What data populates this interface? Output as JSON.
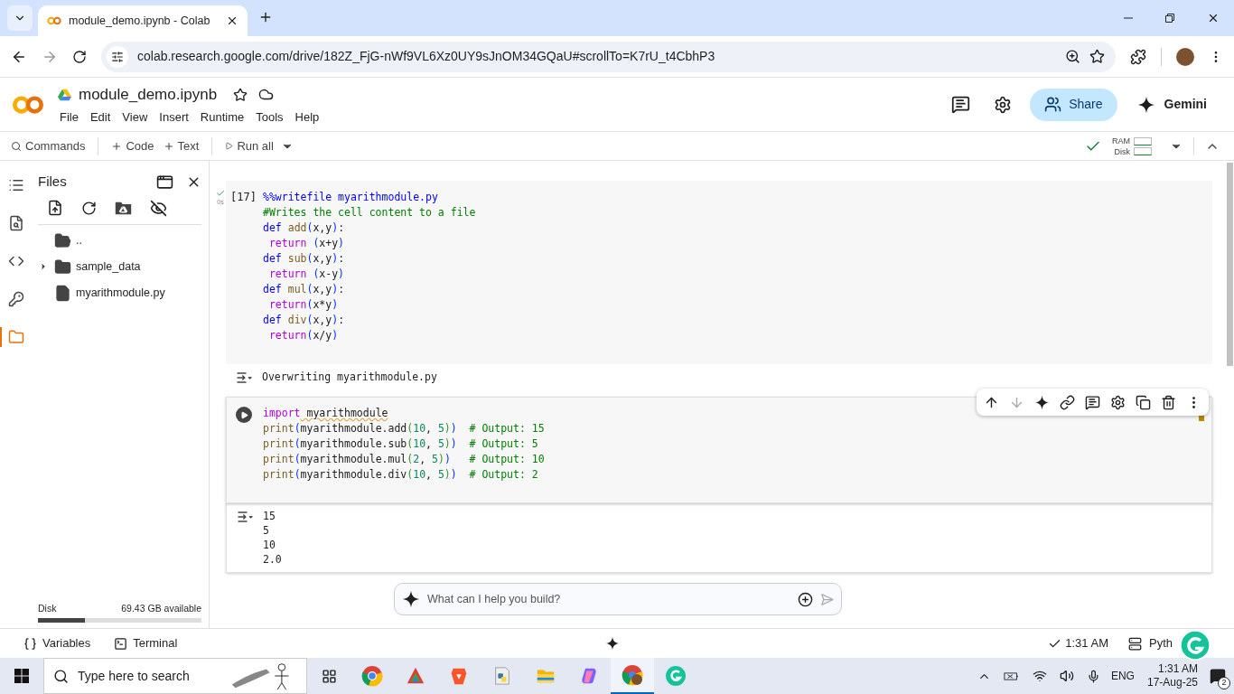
{
  "browser": {
    "tab_title": "module_demo.ipynb - Colab",
    "url": "colab.research.google.com/drive/182Z_FjG-nWf9VL6Xz0UY9sJnOM34GQaU#scrollTo=K7rU_t4CbhP3"
  },
  "notebook": {
    "title": "module_demo.ipynb",
    "menu": [
      "File",
      "Edit",
      "View",
      "Insert",
      "Runtime",
      "Tools",
      "Help"
    ],
    "share": "Share",
    "gemini": "Gemini"
  },
  "toolbar": {
    "commands": "Commands",
    "add_code": "Code",
    "add_text": "Text",
    "run_all": "Run all",
    "ram": "RAM",
    "disk": "Disk"
  },
  "rail": [
    {
      "kind": "toc",
      "selected": false
    },
    {
      "kind": "search",
      "selected": false
    },
    {
      "kind": "code",
      "selected": false
    },
    {
      "kind": "secrets",
      "selected": false
    },
    {
      "kind": "files",
      "selected": true
    }
  ],
  "files_panel": {
    "title": "Files",
    "items": [
      {
        "kind": "parent",
        "name": ".."
      },
      {
        "kind": "folder",
        "name": "sample_data",
        "expanded": false
      },
      {
        "kind": "file",
        "name": "myarithmodule.py"
      }
    ],
    "disk": {
      "label": "Disk",
      "available": "69.43 GB available",
      "level": 0.29
    }
  },
  "cells": [
    {
      "execution_count": "[17]",
      "duration": "0s",
      "selected": false,
      "lines": [
        [
          {
            "kind": "magic",
            "text": "%%writefile myarithmodule.py"
          }
        ],
        [
          {
            "kind": "comment",
            "text": "#Writes the cell content to a file"
          }
        ],
        [
          {
            "kind": "kw",
            "text": "def"
          },
          {
            "kind": "fn",
            "text": " add"
          },
          {
            "kind": "paren",
            "text": "("
          },
          {
            "kind": "plain",
            "text": "x,y"
          },
          {
            "kind": "paren",
            "text": ")"
          },
          {
            "kind": "plain",
            "text": ":"
          }
        ],
        [
          {
            "kind": "ctrl",
            "text": " return"
          },
          {
            "kind": "paren",
            "text": " ("
          },
          {
            "kind": "plain",
            "text": "x+y"
          },
          {
            "kind": "paren",
            "text": ")"
          }
        ],
        [
          {
            "kind": "kw",
            "text": "def"
          },
          {
            "kind": "fn",
            "text": " sub"
          },
          {
            "kind": "paren",
            "text": "("
          },
          {
            "kind": "plain",
            "text": "x,y"
          },
          {
            "kind": "paren",
            "text": ")"
          },
          {
            "kind": "plain",
            "text": ":"
          }
        ],
        [
          {
            "kind": "ctrl",
            "text": " return"
          },
          {
            "kind": "paren",
            "text": " ("
          },
          {
            "kind": "plain",
            "text": "x-y"
          },
          {
            "kind": "paren",
            "text": ")"
          }
        ],
        [
          {
            "kind": "kw",
            "text": "def"
          },
          {
            "kind": "fn",
            "text": " mul"
          },
          {
            "kind": "paren",
            "text": "("
          },
          {
            "kind": "plain",
            "text": "x,y"
          },
          {
            "kind": "paren",
            "text": ")"
          },
          {
            "kind": "plain",
            "text": ":"
          }
        ],
        [
          {
            "kind": "ctrl",
            "text": " return"
          },
          {
            "kind": "paren",
            "text": "("
          },
          {
            "kind": "plain",
            "text": "x*y"
          },
          {
            "kind": "paren",
            "text": ")"
          }
        ],
        [
          {
            "kind": "kw",
            "text": "def"
          },
          {
            "kind": "fn",
            "text": " div"
          },
          {
            "kind": "paren",
            "text": "("
          },
          {
            "kind": "plain",
            "text": "x,y"
          },
          {
            "kind": "paren",
            "text": ")"
          },
          {
            "kind": "plain",
            "text": ":"
          }
        ],
        [
          {
            "kind": "ctrl",
            "text": " return"
          },
          {
            "kind": "paren",
            "text": "("
          },
          {
            "kind": "plain",
            "text": "x/y"
          },
          {
            "kind": "paren",
            "text": ")"
          }
        ]
      ],
      "output": [
        "Overwriting myarithmodule.py"
      ]
    },
    {
      "selected": true,
      "lines": [
        [
          {
            "kind": "ctrl",
            "text": "import"
          },
          {
            "kind": "warn",
            "text": " myarithmodule"
          }
        ],
        [
          {
            "kind": "fn",
            "text": "print"
          },
          {
            "kind": "paren",
            "text": "("
          },
          {
            "kind": "plain",
            "text": "myarithmodule.add"
          },
          {
            "kind": "paren2",
            "text": "("
          },
          {
            "kind": "num",
            "text": "10"
          },
          {
            "kind": "plain",
            "text": ", "
          },
          {
            "kind": "num",
            "text": "5"
          },
          {
            "kind": "paren2",
            "text": ")"
          },
          {
            "kind": "paren",
            "text": ")"
          },
          {
            "kind": "comment",
            "text": "  # Output: 15"
          }
        ],
        [
          {
            "kind": "fn",
            "text": "print"
          },
          {
            "kind": "paren",
            "text": "("
          },
          {
            "kind": "plain",
            "text": "myarithmodule.sub"
          },
          {
            "kind": "paren2",
            "text": "("
          },
          {
            "kind": "num",
            "text": "10"
          },
          {
            "kind": "plain",
            "text": ", "
          },
          {
            "kind": "num",
            "text": "5"
          },
          {
            "kind": "paren2",
            "text": ")"
          },
          {
            "kind": "paren",
            "text": ")"
          },
          {
            "kind": "comment",
            "text": "  # Output: 5"
          }
        ],
        [
          {
            "kind": "fn",
            "text": "print"
          },
          {
            "kind": "paren",
            "text": "("
          },
          {
            "kind": "plain",
            "text": "myarithmodule.mul"
          },
          {
            "kind": "paren2",
            "text": "("
          },
          {
            "kind": "num",
            "text": "2"
          },
          {
            "kind": "plain",
            "text": ", "
          },
          {
            "kind": "num",
            "text": "5"
          },
          {
            "kind": "paren2",
            "text": ")"
          },
          {
            "kind": "paren",
            "text": ")"
          },
          {
            "kind": "comment",
            "text": "   # Output: 10"
          }
        ],
        [
          {
            "kind": "fn",
            "text": "print"
          },
          {
            "kind": "paren",
            "text": "("
          },
          {
            "kind": "plain",
            "text": "myarithmodule.div"
          },
          {
            "kind": "paren2",
            "text": "("
          },
          {
            "kind": "num",
            "text": "10"
          },
          {
            "kind": "plain",
            "text": ", "
          },
          {
            "kind": "num",
            "text": "5"
          },
          {
            "kind": "paren2",
            "text": ")"
          },
          {
            "kind": "paren",
            "text": ")"
          },
          {
            "kind": "comment",
            "text": "  # Output: 2"
          }
        ]
      ],
      "output": [
        "15",
        "5",
        "10",
        "2.0"
      ]
    }
  ],
  "gemini_prompt": {
    "placeholder": "What can I help you build?"
  },
  "status_bar": {
    "variables": "Variables",
    "terminal": "Terminal",
    "time": "1:31 AM",
    "runtime": "Pyth"
  },
  "taskbar": {
    "search_placeholder": "Type here to search",
    "language": "ENG",
    "time": "1:31 AM",
    "date": "17-Aug-25",
    "notifications": "2"
  }
}
